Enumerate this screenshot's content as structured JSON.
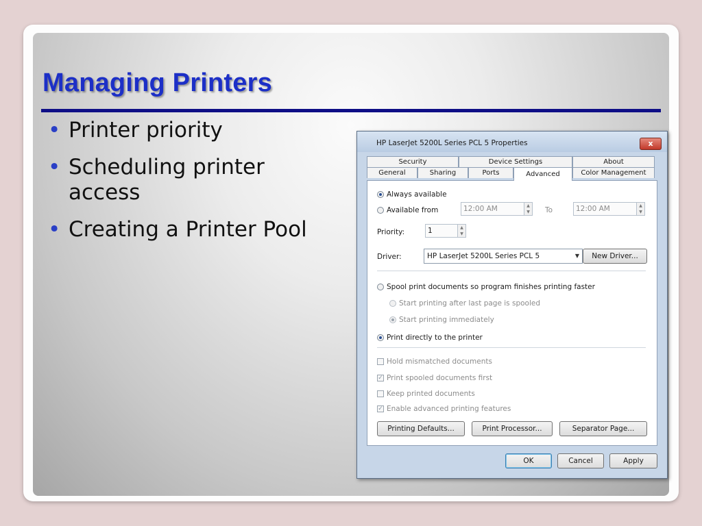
{
  "slide": {
    "title": "Managing Printers",
    "bullets": [
      "Printer priority",
      "Scheduling printer access",
      "Creating a Printer Pool"
    ]
  },
  "dialog": {
    "title": "HP LaserJet 5200L Series PCL 5 Properties",
    "close_label": "x",
    "tabs_row1": [
      "Security",
      "Device Settings",
      "About"
    ],
    "tabs_row2": [
      "General",
      "Sharing",
      "Ports",
      "Advanced",
      "Color Management"
    ],
    "active_tab": "Advanced",
    "availability": {
      "always_label": "Always available",
      "from_label": "Available from",
      "from_time": "12:00 AM",
      "to_label": "To",
      "to_time": "12:00 AM",
      "selected": "always"
    },
    "priority": {
      "label": "Priority:",
      "value": "1"
    },
    "driver": {
      "label": "Driver:",
      "value": "HP LaserJet 5200L Series PCL 5",
      "new_driver_label": "New Driver..."
    },
    "spool": {
      "spool_label": "Spool print documents so program finishes printing faster",
      "after_last_label": "Start printing after last page is spooled",
      "immediately_label": "Start printing immediately",
      "direct_label": "Print directly to the printer",
      "selected": "direct"
    },
    "options": [
      {
        "label": "Hold mismatched documents",
        "checked": false
      },
      {
        "label": "Print spooled documents first",
        "checked": true
      },
      {
        "label": "Keep printed documents",
        "checked": false
      },
      {
        "label": "Enable advanced printing features",
        "checked": true
      }
    ],
    "buttons": {
      "printing_defaults": "Printing Defaults...",
      "print_processor": "Print Processor...",
      "separator_page": "Separator Page...",
      "ok": "OK",
      "cancel": "Cancel",
      "apply": "Apply"
    },
    "colors": {
      "radio_checked": "#2a4f92",
      "title_blue": "#1c2fc7"
    }
  }
}
